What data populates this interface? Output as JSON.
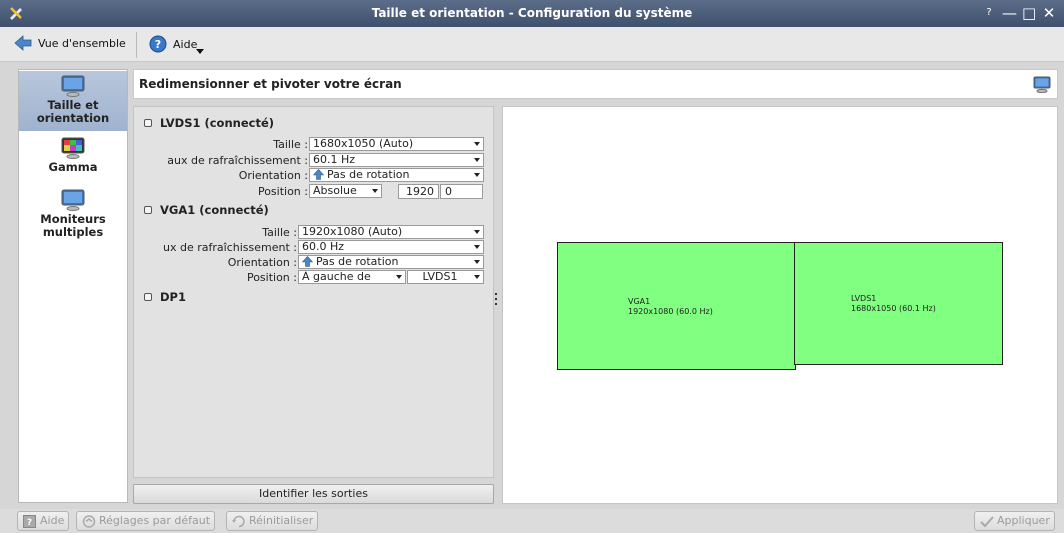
{
  "window": {
    "title": "Taille et orientation - Configuration du système",
    "help_glyph": "?",
    "minimize_glyph": "—",
    "maximize_glyph": "□",
    "close_glyph": "✕"
  },
  "toolbar": {
    "overview_label": "Vue d'ensemble",
    "help_label": "Aide"
  },
  "sidebar": {
    "items": [
      {
        "label": "Taille et orientation",
        "icon": "monitor-icon",
        "selected": true
      },
      {
        "label": "Gamma",
        "icon": "gamma-monitor-icon",
        "selected": false
      },
      {
        "label": "Moniteurs multiples",
        "icon": "monitor-icon",
        "selected": false
      }
    ]
  },
  "header": {
    "title": "Redimensionner et pivoter votre écran"
  },
  "outputs": {
    "lvds1": {
      "name": "LVDS1 (connecté)",
      "size_label": "Taille :",
      "size_value": "1680x1050 (Auto)",
      "refresh_label": "aux de rafraîchissement :",
      "refresh_value": "60.1 Hz",
      "orientation_label": "Orientation :",
      "orientation_value": "Pas de rotation",
      "position_label": "Position :",
      "position_mode": "Absolue",
      "position_x": "1920",
      "position_y": "0"
    },
    "vga1": {
      "name": "VGA1 (connecté)",
      "size_label": "Taille :",
      "size_value": "1920x1080 (Auto)",
      "refresh_label": "ux de rafraîchissement :",
      "refresh_value": "60.0 Hz",
      "orientation_label": "Orientation :",
      "orientation_value": "Pas de rotation",
      "position_label": "Position :",
      "position_mode": "À gauche de",
      "position_ref": "LVDS1"
    },
    "dp1": {
      "name": "DP1"
    }
  },
  "identify_label": "Identifier les sorties",
  "canvas": {
    "screens": [
      {
        "name": "VGA1",
        "mode": "1920x1080 (60.0 Hz)"
      },
      {
        "name": "LVDS1",
        "mode": "1680x1050 (60.1 Hz)"
      }
    ]
  },
  "bottom": {
    "help_label": "Aide",
    "defaults_label": "Réglages par défaut",
    "reset_label": "Réinitialiser",
    "apply_label": "Appliquer"
  },
  "colors": {
    "screen_fill": "#80ff80",
    "titlebar": "#4a5c78",
    "selected_category": "#a8b9d4"
  }
}
